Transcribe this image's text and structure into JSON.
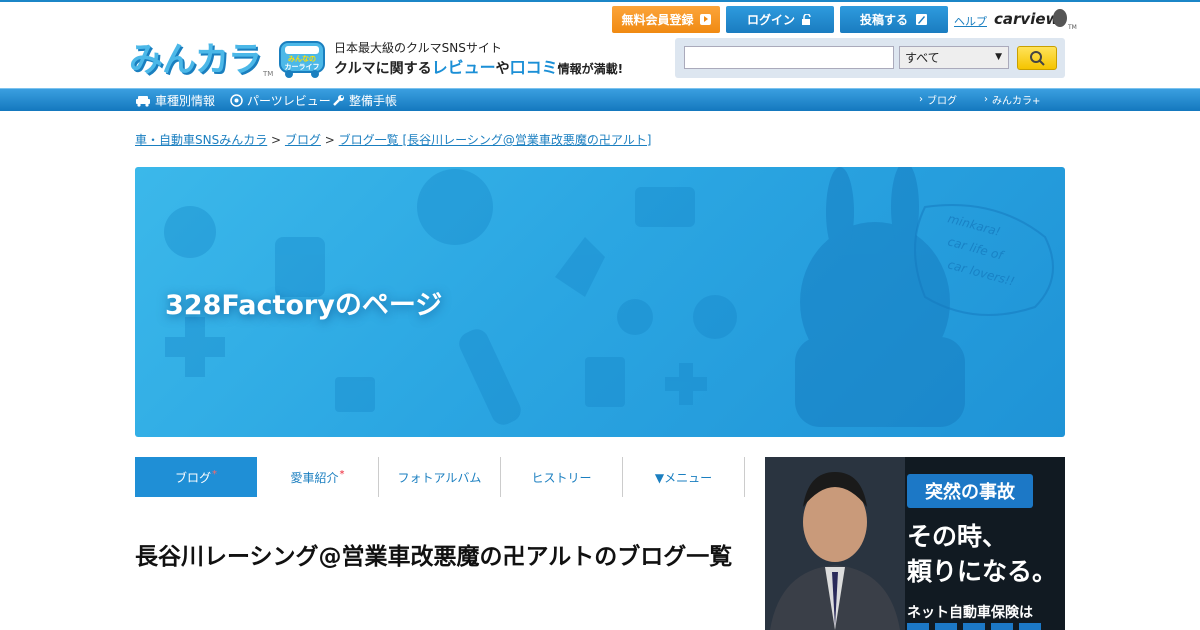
{
  "header": {
    "logo_text": "みんカラ",
    "logo_tm": "TM",
    "badge_line1": "みんなの",
    "badge_line2": "カーライフ",
    "tagline_1": "日本最大級のクルマSNSサイト",
    "tagline_2a": "クルマに関する",
    "tagline_2b": "レビュー",
    "tagline_2c": "や",
    "tagline_2d": "口コミ",
    "tagline_2e": "情報が満載!",
    "register_label": "無料会員登録",
    "login_label": "ログイン",
    "post_label": "投稿する",
    "help_label": "ヘルプ",
    "carview_label": "carview",
    "carview_tm": "TM"
  },
  "search": {
    "value": "",
    "placeholder": "",
    "select_value": "すべて"
  },
  "nav": {
    "left": [
      {
        "label": "車種別情報",
        "icon": "car-icon"
      },
      {
        "label": "パーツレビュー",
        "icon": "parts-icon"
      },
      {
        "label": "整備手帳",
        "icon": "wrench-icon"
      }
    ],
    "right": [
      {
        "label": "ブログ"
      },
      {
        "label": "みんカラ+"
      }
    ]
  },
  "breadcrumb": {
    "items": [
      "車・自動車SNSみんカラ",
      "ブログ",
      "ブログ一覧 [長谷川レーシング@営業車改悪魔の卍アルト]"
    ],
    "separator": ">"
  },
  "hero": {
    "title": "328Factoryのページ",
    "art_text_1": "minkara!",
    "art_text_2": "car life of",
    "art_text_3": "car lovers!!"
  },
  "tabs": [
    {
      "label": "ブログ",
      "star": "*",
      "active": true
    },
    {
      "label": "愛車紹介",
      "star": "*",
      "active": false
    },
    {
      "label": "フォトアルバム",
      "star": "",
      "active": false
    },
    {
      "label": "ヒストリー",
      "star": "",
      "active": false
    },
    {
      "label": "▼メニュー",
      "star": "",
      "active": false
    }
  ],
  "page_title": "長谷川レーシング@営業車改悪魔の卍アルトのブログ一覧",
  "ad": {
    "badge": "突然の事故",
    "line1": "その時、",
    "line2": "頼りになる。",
    "line3": "ネット自動車保険は"
  },
  "colors": {
    "brand_blue": "#1f8fd6",
    "orange": "#f08a12",
    "link": "#1b7fc0"
  }
}
